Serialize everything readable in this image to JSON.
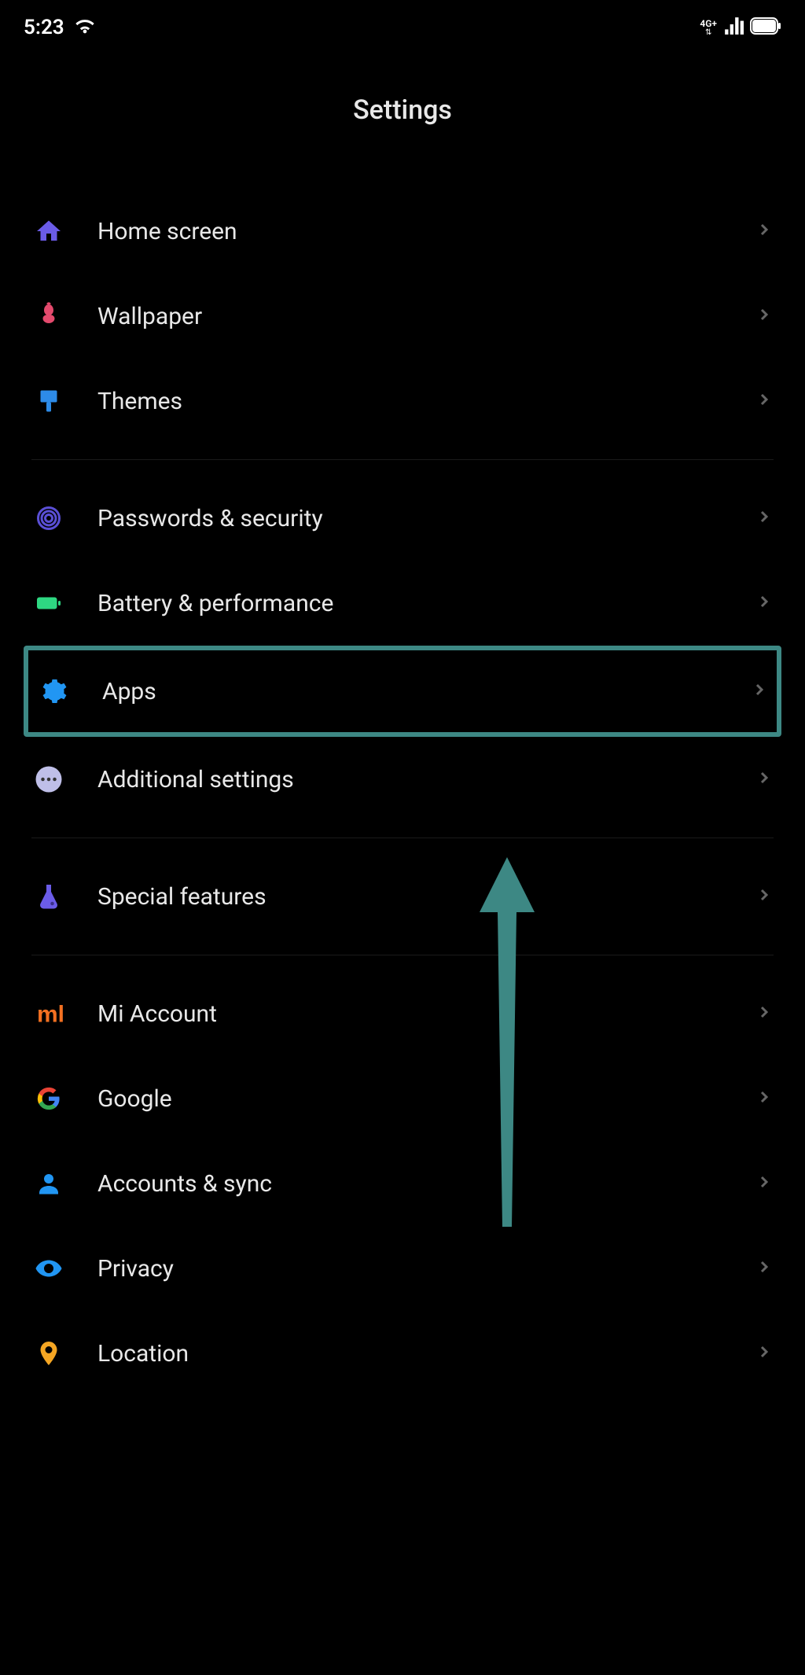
{
  "status_bar": {
    "time": "5:23",
    "network": "4G+"
  },
  "header": {
    "title": "Settings"
  },
  "groups": [
    {
      "items": [
        {
          "id": "home_screen",
          "label": "Home screen",
          "icon": "home",
          "color": "#6b5ce8"
        },
        {
          "id": "wallpaper",
          "label": "Wallpaper",
          "icon": "flower",
          "color": "#e44a6d"
        },
        {
          "id": "themes",
          "label": "Themes",
          "icon": "brush",
          "color": "#2d8be8"
        }
      ]
    },
    {
      "items": [
        {
          "id": "passwords_security",
          "label": "Passwords & security",
          "icon": "fingerprint",
          "color": "#5a4fd6"
        },
        {
          "id": "battery_performance",
          "label": "Battery & performance",
          "icon": "battery",
          "color": "#2ed882"
        },
        {
          "id": "apps",
          "label": "Apps",
          "icon": "gear",
          "color": "#2196f3",
          "highlighted": true
        },
        {
          "id": "additional_settings",
          "label": "Additional settings",
          "icon": "dots",
          "color": "#bfbfe8"
        }
      ]
    },
    {
      "items": [
        {
          "id": "special_features",
          "label": "Special features",
          "icon": "flask",
          "color": "#6b5ce8"
        }
      ]
    },
    {
      "items": [
        {
          "id": "mi_account",
          "label": "Mi Account",
          "icon": "mi",
          "color": "#f37021"
        },
        {
          "id": "google",
          "label": "Google",
          "icon": "google",
          "color": ""
        },
        {
          "id": "accounts_sync",
          "label": "Accounts & sync",
          "icon": "person",
          "color": "#2196f3"
        },
        {
          "id": "privacy",
          "label": "Privacy",
          "icon": "eye",
          "color": "#2196f3"
        },
        {
          "id": "location",
          "label": "Location",
          "icon": "pin",
          "color": "#f5a623"
        }
      ]
    }
  ]
}
